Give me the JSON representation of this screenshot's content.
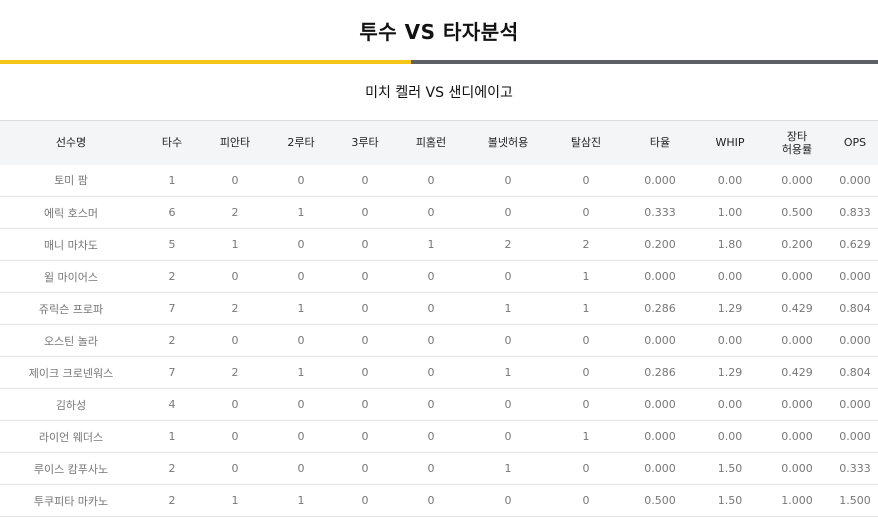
{
  "title": "투수 VS 타자분석",
  "subtitle": "미치 켈러 VS 샌디에이고",
  "table": {
    "headers": [
      "선수명",
      "타수",
      "피안타",
      "2루타",
      "3루타",
      "피홈런",
      "볼넷허용",
      "탈삼진",
      "타율",
      "WHIP",
      "장타\n허용률",
      "OPS"
    ],
    "rows": [
      [
        "토미 팜",
        "1",
        "0",
        "0",
        "0",
        "0",
        "0",
        "0",
        "0.000",
        "0.00",
        "0.000",
        "0.000"
      ],
      [
        "에릭 호스머",
        "6",
        "2",
        "1",
        "0",
        "0",
        "0",
        "0",
        "0.333",
        "1.00",
        "0.500",
        "0.833"
      ],
      [
        "매니 마차도",
        "5",
        "1",
        "0",
        "0",
        "1",
        "2",
        "2",
        "0.200",
        "1.80",
        "0.200",
        "0.629"
      ],
      [
        "윌 마이어스",
        "2",
        "0",
        "0",
        "0",
        "0",
        "0",
        "1",
        "0.000",
        "0.00",
        "0.000",
        "0.000"
      ],
      [
        "쥬릭슨 프로파",
        "7",
        "2",
        "1",
        "0",
        "0",
        "1",
        "1",
        "0.286",
        "1.29",
        "0.429",
        "0.804"
      ],
      [
        "오스틴 놀라",
        "2",
        "0",
        "0",
        "0",
        "0",
        "0",
        "0",
        "0.000",
        "0.00",
        "0.000",
        "0.000"
      ],
      [
        "제이크 크로넨워스",
        "7",
        "2",
        "1",
        "0",
        "0",
        "1",
        "0",
        "0.286",
        "1.29",
        "0.429",
        "0.804"
      ],
      [
        "김하성",
        "4",
        "0",
        "0",
        "0",
        "0",
        "0",
        "0",
        "0.000",
        "0.00",
        "0.000",
        "0.000"
      ],
      [
        "라이언 웨더스",
        "1",
        "0",
        "0",
        "0",
        "0",
        "0",
        "1",
        "0.000",
        "0.00",
        "0.000",
        "0.000"
      ],
      [
        "루이스 캄푸사노",
        "2",
        "0",
        "0",
        "0",
        "0",
        "1",
        "0",
        "0.000",
        "1.50",
        "0.000",
        "0.333"
      ],
      [
        "투쿠피타 마카노",
        "2",
        "1",
        "1",
        "0",
        "0",
        "0",
        "0",
        "0.500",
        "1.50",
        "1.000",
        "1.500"
      ]
    ]
  },
  "colors": {
    "accent_yellow": "#f5c518",
    "accent_gray": "#5b6167",
    "header_bg": "#f4f5f6"
  }
}
